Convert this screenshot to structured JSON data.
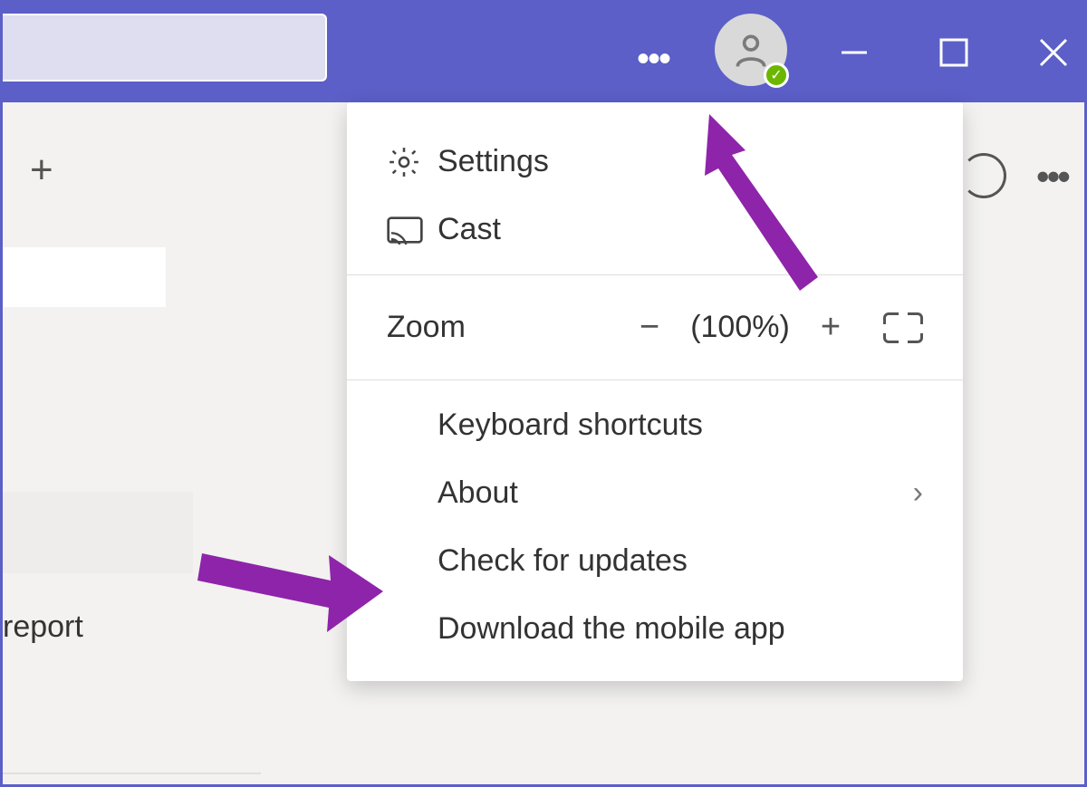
{
  "titlebar": {
    "search_value": "",
    "presence": "available"
  },
  "menu": {
    "settings_label": "Settings",
    "cast_label": "Cast",
    "zoom_label": "Zoom",
    "zoom_value": "(100%)",
    "keyboard_label": "Keyboard shortcuts",
    "about_label": "About",
    "check_updates_label": "Check for updates",
    "download_app_label": "Download the mobile app"
  },
  "background": {
    "partial_text": "report"
  }
}
